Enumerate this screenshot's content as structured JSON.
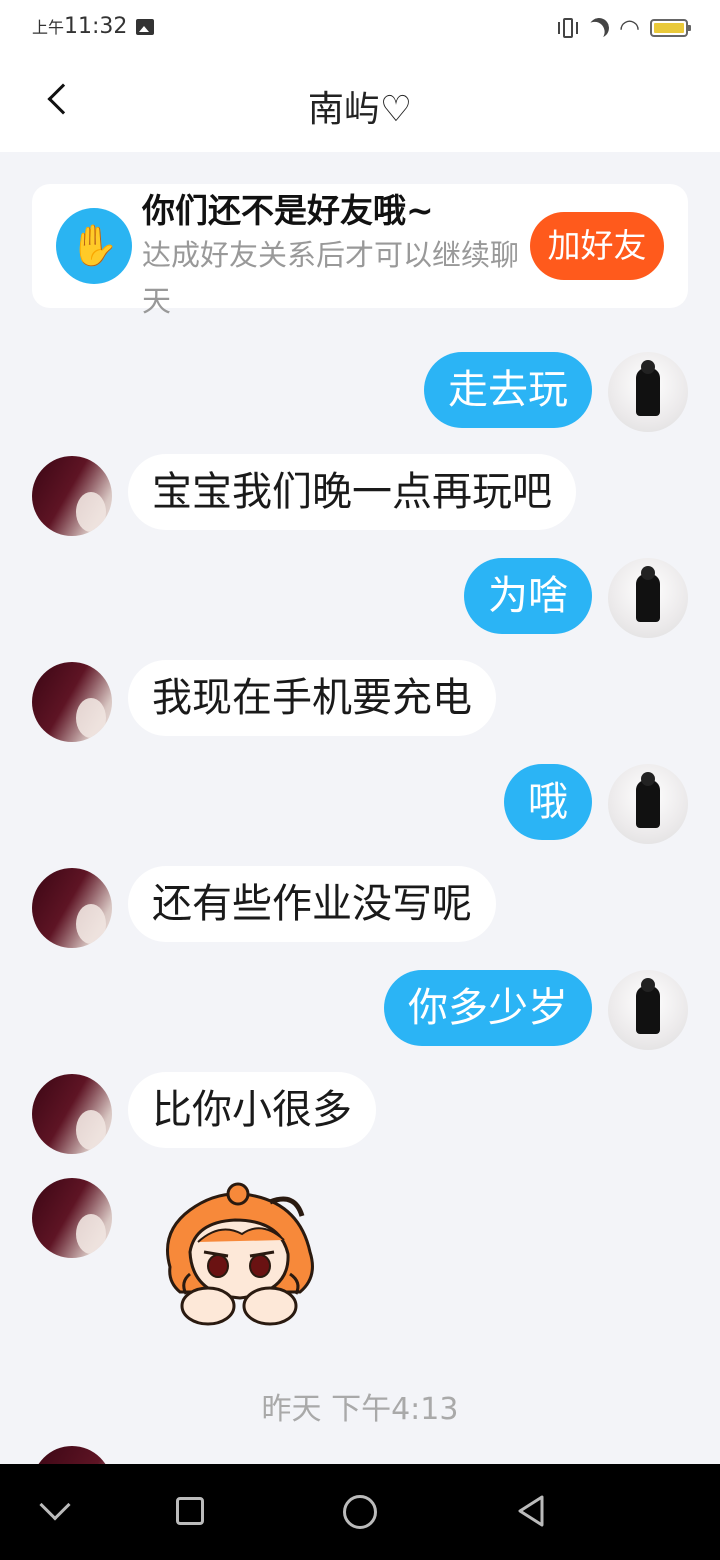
{
  "status_bar": {
    "ampm": "上午",
    "time": "11:32"
  },
  "header": {
    "title": "南屿♡"
  },
  "notice": {
    "title": "你们还不是好友哦~",
    "description": "达成好友关系后才可以继续聊天",
    "add_friend_label": "加好友"
  },
  "messages": [
    {
      "sender": "self",
      "text": "走去玩"
    },
    {
      "sender": "other",
      "text": "宝宝我们晚一点再玩吧"
    },
    {
      "sender": "self",
      "text": "为啥"
    },
    {
      "sender": "other",
      "text": "我现在手机要充电"
    },
    {
      "sender": "self",
      "text": "哦"
    },
    {
      "sender": "other",
      "text": "还有些作业没写呢"
    },
    {
      "sender": "self",
      "text": "你多少岁"
    },
    {
      "sender": "other",
      "text": "比你小很多"
    }
  ],
  "timestamp": "昨天 下午4:13",
  "colors": {
    "self_bubble": "#2bb4f5",
    "add_friend": "#ff5a1c",
    "background": "#f3f4f8"
  }
}
